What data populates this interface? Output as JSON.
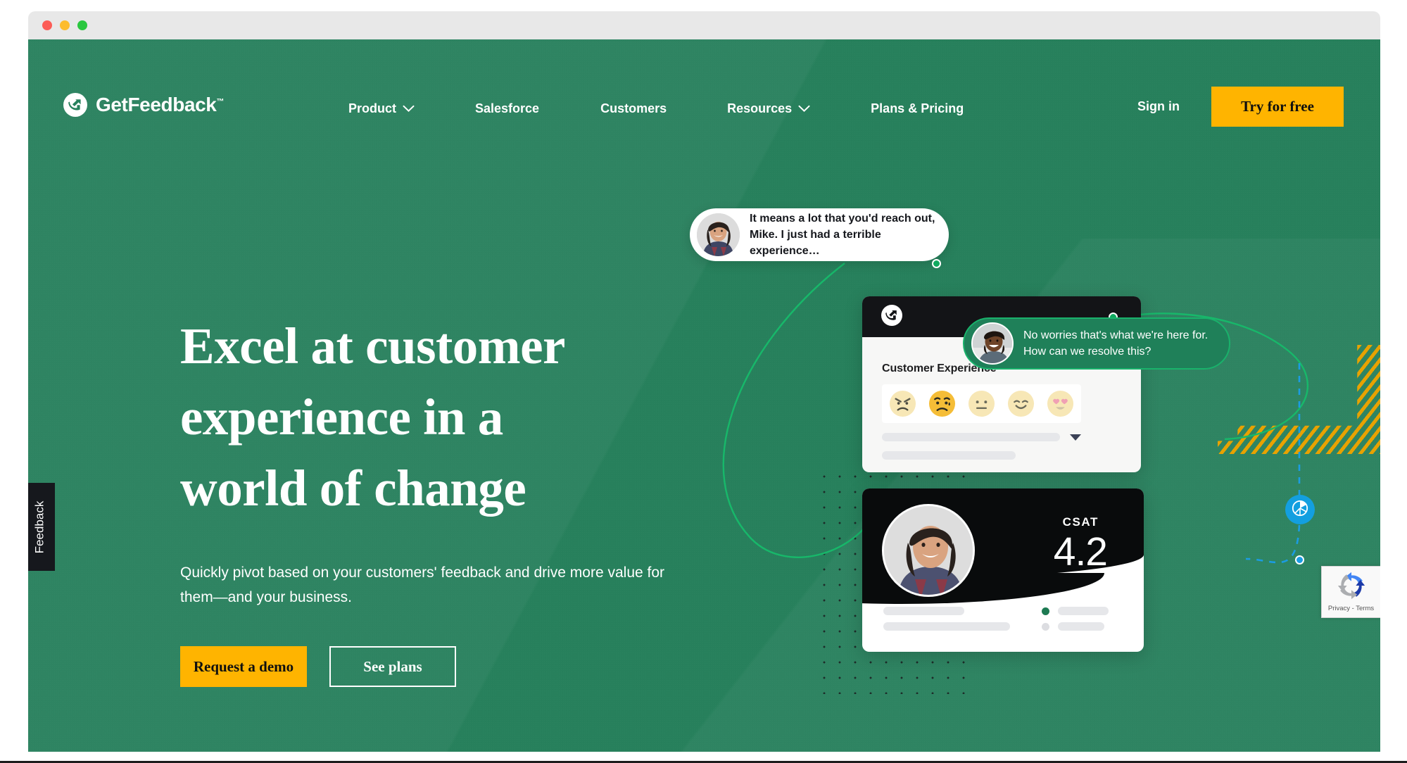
{
  "window": {
    "traffic_lights": [
      "close",
      "minimize",
      "maximize"
    ]
  },
  "brand": {
    "name": "GetFeedback",
    "trademark": "™",
    "logo_icon": "getfeedback-logo-icon",
    "green": "#27805c",
    "yellow": "#ffb400",
    "dark": "#16181d",
    "blue": "#139fe0"
  },
  "nav": {
    "items": [
      {
        "label": "Product",
        "has_dropdown": true,
        "chevron_icon": "chevron-down-icon"
      },
      {
        "label": "Salesforce",
        "has_dropdown": false
      },
      {
        "label": "Customers",
        "has_dropdown": false
      },
      {
        "label": "Resources",
        "has_dropdown": true,
        "chevron_icon": "chevron-down-icon"
      },
      {
        "label": "Plans & Pricing",
        "has_dropdown": false
      }
    ],
    "sign_in": "Sign in",
    "cta": "Try for free"
  },
  "hero": {
    "title_lines": [
      "Excel at customer",
      "experience in a",
      "world of change"
    ],
    "title": "Excel at customer experience in a world of change",
    "subtitle": "Quickly pivot based on your customers' feedback and drive more value for them—and your business.",
    "primary_button": "Request a demo",
    "secondary_button": "See plans"
  },
  "feedback_tab": {
    "label": "Feedback"
  },
  "illustration": {
    "bubble_customer": {
      "text": "It means a lot that you'd reach out, Mike. I just had a terrible experience…",
      "avatar": "customer-avatar"
    },
    "bubble_agent": {
      "text": "No worries that's what we're here for. How can we resolve this?",
      "avatar": "agent-avatar"
    },
    "survey_card": {
      "logo_icon": "getfeedback-mark-icon",
      "question_label": "Customer Experience",
      "emoji_options": [
        "angry-face-icon",
        "sad-face-icon",
        "neutral-face-icon",
        "smiling-face-icon",
        "heart-eyes-face-icon"
      ],
      "selected_emoji_index": 1,
      "dropdown_icon": "caret-down-icon"
    },
    "csat_card": {
      "metric_label": "CSAT",
      "metric_value": "4.2",
      "avatar": "agent-profile-avatar",
      "legend_active_color": "#1d7a52"
    },
    "chart_badge_icon": "pie-chart-icon"
  },
  "recaptcha": {
    "icon": "recaptcha-icon",
    "text": "Privacy - Terms"
  }
}
